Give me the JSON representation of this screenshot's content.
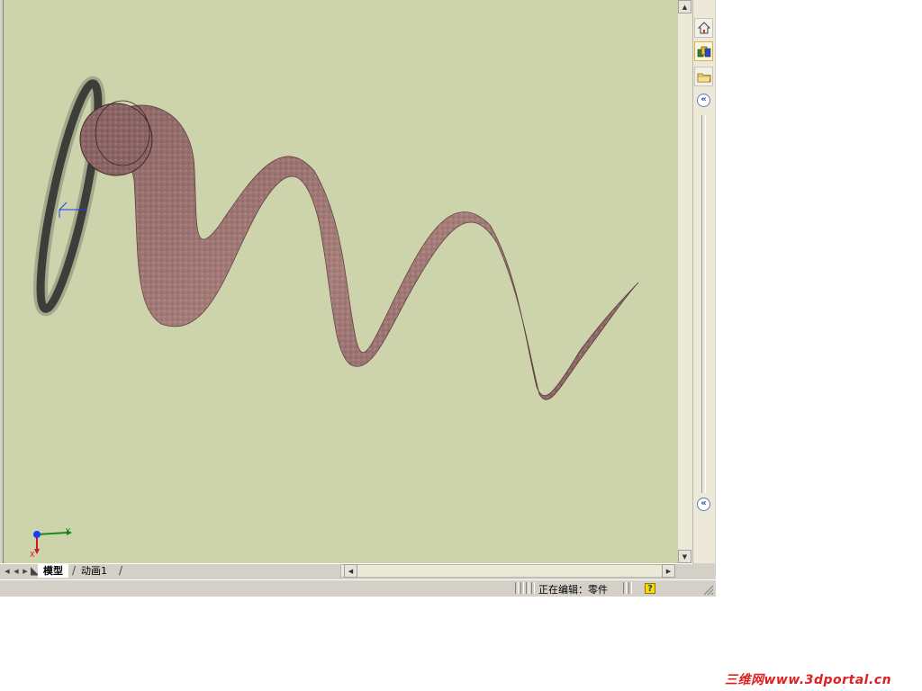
{
  "tabs": [
    {
      "label": "模型",
      "active": true
    },
    {
      "label": "动画1",
      "active": false
    }
  ],
  "triad": {
    "x_label": "X",
    "y_label": "Y"
  },
  "status": {
    "editing": "正在编辑：零件"
  },
  "icons": {
    "home": "home-icon",
    "appearance": "color-palette-icon",
    "folder": "folder-icon",
    "collapse": "double-chevron-left-icon",
    "help": "help-icon"
  },
  "watermark": "三维网www.3dportal.cn",
  "colors": {
    "viewport_bg": "#cdd3ab",
    "coil_texture": "#9a6f6c",
    "watermark": "#e02020"
  }
}
